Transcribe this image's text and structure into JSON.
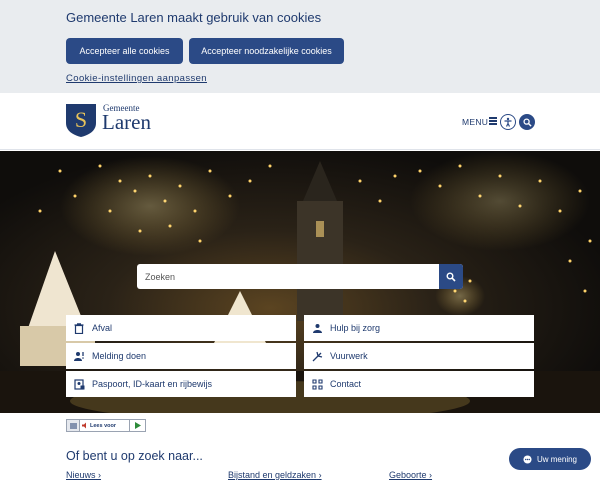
{
  "cookie": {
    "title": "Gemeente Laren maakt gebruik van cookies",
    "accept_all": "Accepteer alle cookies",
    "accept_necessary": "Accepteer noodzakelijke cookies",
    "settings_link": "Cookie-instellingen aanpassen"
  },
  "header": {
    "logo_small": "Gemeente",
    "logo_big": "Laren",
    "logo_letter": "S",
    "menu_label": "MENU",
    "icons": [
      "hamburger-icon",
      "accessibility-icon",
      "search-icon"
    ]
  },
  "search": {
    "placeholder": "Zoeken"
  },
  "tiles": [
    {
      "label": "Afval",
      "icon": "trash-icon"
    },
    {
      "label": "Hulp bij zorg",
      "icon": "care-icon"
    },
    {
      "label": "Melding doen",
      "icon": "report-icon"
    },
    {
      "label": "Vuurwerk",
      "icon": "fireworks-icon"
    },
    {
      "label": "Paspoort, ID-kaart en rijbewijs",
      "icon": "passport-icon"
    },
    {
      "label": "Contact",
      "icon": "contact-icon"
    }
  ],
  "readspeaker": {
    "label": "Lees voor"
  },
  "lookfor": {
    "title": "Of bent u op zoek naar...",
    "links": [
      "Nieuws",
      "Bijstand en geldzaken",
      "Geboorte"
    ]
  },
  "opinion": {
    "label": "Uw mening"
  },
  "colors": {
    "primary": "#2b4a86",
    "text": "#1f3a6e",
    "banner_bg": "#e9ecef"
  }
}
